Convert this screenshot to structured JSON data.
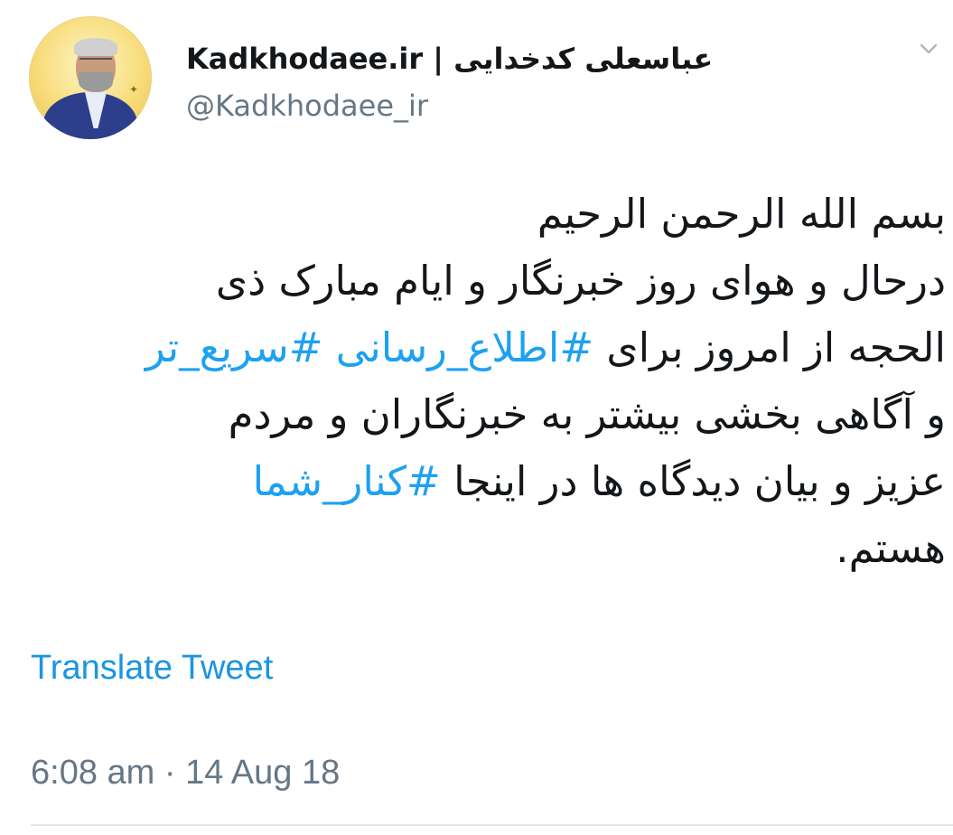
{
  "author": {
    "display_name": "Kadkhodaee.ir | عباسعلی کدخدایی",
    "handle": "@Kadkhodaee_ir"
  },
  "tweet": {
    "lines": [
      [
        {
          "text": "بسم الله الرحمن الرحیم",
          "hashtag": false
        }
      ],
      [
        {
          "text": "درحال و هوای روز خبرنگار و ایام مبارک ذی",
          "hashtag": false
        }
      ],
      [
        {
          "text": "الحجه از امروز برای ",
          "hashtag": false
        },
        {
          "text": "#اطلاع_رسانی",
          "hashtag": true
        },
        {
          "text": " ",
          "hashtag": false
        },
        {
          "text": "#سریع_تر",
          "hashtag": true
        }
      ],
      [
        {
          "text": "و آگاهی بخشی بیشتر به خبرنگاران و مردم",
          "hashtag": false
        }
      ],
      [
        {
          "text": "عزیز و بیان دیدگاه ها در اینجا ",
          "hashtag": false
        },
        {
          "text": "#کنار_شما",
          "hashtag": true
        }
      ],
      [
        {
          "text": "هستم.",
          "hashtag": false
        }
      ]
    ]
  },
  "actions": {
    "translate_label": "Translate Tweet"
  },
  "meta": {
    "timestamp": "6:08 am · 14 Aug 18"
  },
  "colors": {
    "hashtag": "#1da1f2",
    "link": "#1b95e0",
    "secondary_text": "#657786",
    "primary_text": "#14171a"
  },
  "icons": {
    "menu": "chevron-down-icon",
    "avatar": "profile-photo"
  }
}
